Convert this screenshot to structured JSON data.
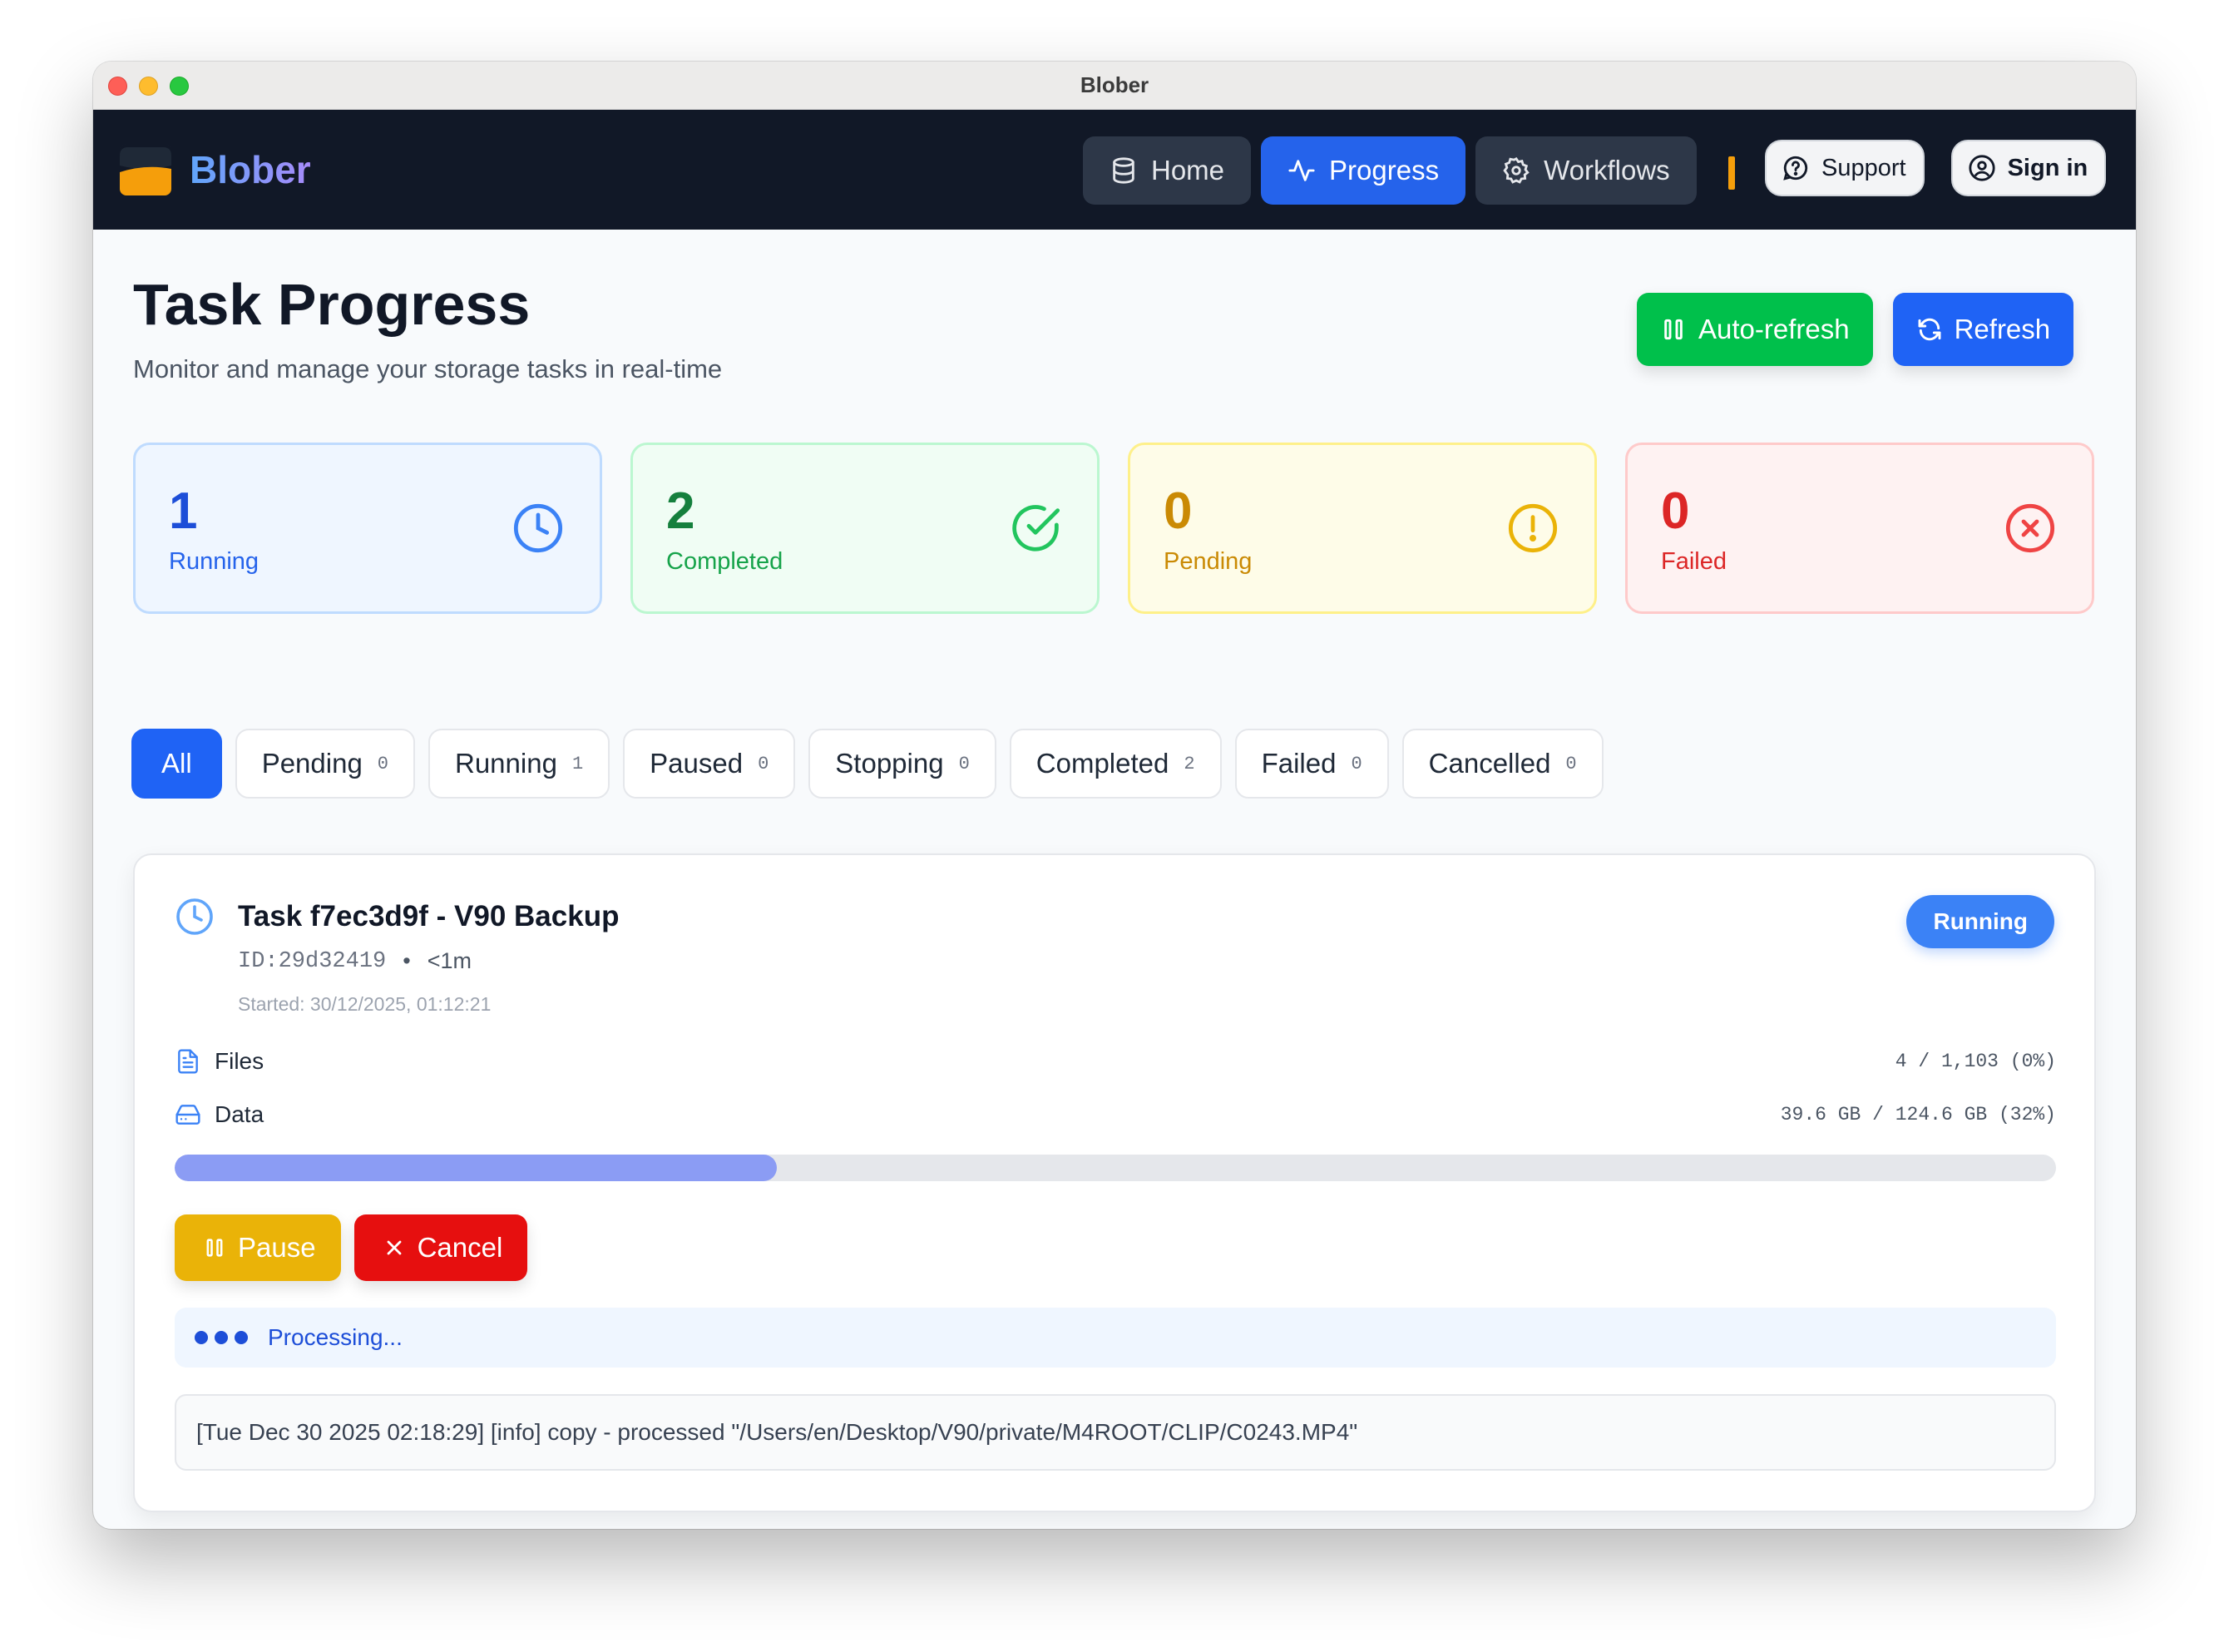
{
  "window": {
    "title": "Blober"
  },
  "nav": {
    "brand": "Blober",
    "links": [
      {
        "label": "Home",
        "icon": "database-icon",
        "active": false
      },
      {
        "label": "Progress",
        "icon": "activity-icon",
        "active": true
      },
      {
        "label": "Workflows",
        "icon": "gear-icon",
        "active": false
      }
    ],
    "support_label": "Support",
    "signin_label": "Sign in"
  },
  "header": {
    "title": "Task Progress",
    "subtitle": "Monitor and manage your storage tasks in real-time",
    "autorefresh_label": "Auto-refresh",
    "refresh_label": "Refresh"
  },
  "stats": {
    "running": {
      "count": "1",
      "label": "Running"
    },
    "completed": {
      "count": "2",
      "label": "Completed"
    },
    "pending": {
      "count": "0",
      "label": "Pending"
    },
    "failed": {
      "count": "0",
      "label": "Failed"
    }
  },
  "filters": [
    {
      "label": "All",
      "count": ""
    },
    {
      "label": "Pending",
      "count": "0"
    },
    {
      "label": "Running",
      "count": "1"
    },
    {
      "label": "Paused",
      "count": "0"
    },
    {
      "label": "Stopping",
      "count": "0"
    },
    {
      "label": "Completed",
      "count": "2"
    },
    {
      "label": "Failed",
      "count": "0"
    },
    {
      "label": "Cancelled",
      "count": "0"
    }
  ],
  "task": {
    "title": "Task f7ec3d9f - V90 Backup",
    "id": "ID:29d32419",
    "separator": "•",
    "duration": "<1m",
    "started": "Started: 30/12/2025, 01:12:21",
    "status": "Running",
    "files_label": "Files",
    "files_value": "4 / 1,103 (0%)",
    "data_label": "Data",
    "data_value": "39.6 GB / 124.6 GB (32%)",
    "progress_fraction": 0.32,
    "pause_label": "Pause",
    "cancel_label": "Cancel",
    "processing_text": "Processing...",
    "log": "[Tue Dec 30 2025 02:18:29] [info] copy - processed \"/Users/en/Desktop/V90/private/M4ROOT/CLIP/C0243.MP4\""
  },
  "colors": {
    "navbar_bg": "#111827",
    "primary": "#1f63f5",
    "success": "#00c04b",
    "warning": "#eab308",
    "danger": "#e60f0f",
    "progress_fill": "#8b9cf4"
  }
}
